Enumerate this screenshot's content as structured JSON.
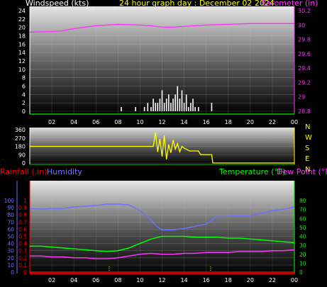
{
  "header": {
    "windspeed_label": "Windspeed (kts)",
    "graph_day": "24 hour graph day : December 02 2024",
    "barometer_label": "Barometer (in)"
  },
  "colors": {
    "background": "#000000",
    "grid": "#c8c8c8",
    "tick_text": "#ffffff",
    "axis_green": "#00cc00",
    "barometer": "#ff33ff",
    "wind_speed": "#ffffff",
    "wind_dir": "#ffff00",
    "rainfall": "#ff0000",
    "humidity": "#7070ff",
    "temperature": "#00ff00",
    "dew_point": "#ff33ff",
    "x_labels": "#ffffff",
    "right_axis_labels": "#ffff00"
  },
  "chart_data": [
    {
      "type": "line",
      "name": "wind-barometer",
      "title": "24 hour graph day : December 02 2024",
      "xlabel": "",
      "ylabel": "Windspeed (kts)",
      "y2label": "Barometer (in)",
      "x_ticks": [
        "02",
        "04",
        "06",
        "08",
        "10",
        "12",
        "14",
        "16",
        "18",
        "20",
        "22",
        "00"
      ],
      "xlim": [
        0,
        24
      ],
      "ylim": [
        0,
        24
      ],
      "y_ticks": [
        "0",
        "2",
        "4",
        "6",
        "8",
        "10",
        "12",
        "14",
        "16",
        "18",
        "20",
        "22",
        "24"
      ],
      "y2lim": [
        28.8,
        30.2
      ],
      "y2_ticks": [
        "28.8",
        "29",
        "29.2",
        "29.4",
        "29.6",
        "29.8",
        "30",
        "30.2"
      ],
      "series": [
        {
          "type": "line",
          "axis": "right",
          "color_key": "barometer",
          "x": [
            0,
            2,
            3,
            4,
            6,
            8,
            10,
            11,
            12,
            13,
            14,
            16,
            18,
            20,
            22,
            24
          ],
          "y": [
            29.9,
            29.91,
            29.92,
            29.95,
            29.99,
            30.01,
            30.0,
            29.99,
            29.97,
            29.97,
            29.98,
            30.0,
            30.01,
            30.02,
            30.02,
            30.02
          ]
        },
        {
          "type": "bar",
          "axis": "left",
          "color_key": "wind_speed",
          "x": [
            8.3,
            9.6,
            10.4,
            10.7,
            11.0,
            11.2,
            11.4,
            11.6,
            11.8,
            12.0,
            12.2,
            12.4,
            12.6,
            12.8,
            13.0,
            13.2,
            13.4,
            13.6,
            13.8,
            14.0,
            14.2,
            14.4,
            14.6,
            14.8,
            15.0,
            15.3,
            16.5
          ],
          "y": [
            1,
            1,
            1,
            2,
            1,
            3,
            2,
            2,
            3,
            5,
            2,
            3,
            4,
            2,
            3,
            4,
            6,
            3,
            5,
            2,
            4,
            1,
            2,
            3,
            1,
            1,
            2
          ]
        }
      ]
    },
    {
      "type": "line",
      "name": "wind-direction",
      "xlim": [
        0,
        24
      ],
      "ylim": [
        0,
        360
      ],
      "y_ticks": [
        "0",
        "90",
        "180",
        "270",
        "360"
      ],
      "y_ticks_values": [
        0,
        90,
        180,
        270,
        360
      ],
      "compass_labels": [
        "N",
        "W",
        "S",
        "E",
        "N"
      ],
      "x": [
        0,
        11.2,
        11.4,
        11.6,
        11.8,
        12.0,
        12.2,
        12.4,
        12.6,
        12.8,
        13.0,
        13.2,
        13.4,
        13.6,
        13.8,
        14.0,
        14.5,
        15.0,
        15.3,
        15.5,
        16.0,
        16.3,
        16.5,
        16.6,
        24
      ],
      "y": [
        180,
        180,
        330,
        120,
        260,
        70,
        300,
        40,
        200,
        110,
        250,
        150,
        210,
        120,
        180,
        160,
        130,
        130,
        130,
        90,
        90,
        90,
        90,
        0,
        0
      ]
    },
    {
      "type": "line",
      "name": "humidity-temperature",
      "left_labels": {
        "rainfall": "Rainfall (.in)",
        "humidity": "Humidity"
      },
      "right_labels": {
        "temperature": "Temperature (°F)",
        "dew_point": "Dew Point (°F)"
      },
      "x_ticks": [
        "02",
        "04",
        "06",
        "08",
        "10",
        "12",
        "14",
        "16",
        "18",
        "20",
        "22",
        "00"
      ],
      "xlim": [
        0,
        24
      ],
      "humidity_ticks": [
        "0",
        "10",
        "20",
        "30",
        "40",
        "50",
        "60",
        "70",
        "80",
        "90",
        "100"
      ],
      "humidity_lim": [
        0,
        100
      ],
      "rain_ticks": [
        "0",
        "0.1",
        "0.2",
        "0.3",
        "0.4",
        "0.5",
        "0.6",
        "0.7",
        "0.8",
        "0.9",
        "1"
      ],
      "rain_lim": [
        0,
        1
      ],
      "temp_ticks": [
        "0",
        "10",
        "20",
        "30",
        "40",
        "50",
        "60",
        "70",
        "80"
      ],
      "temp_lim": [
        0,
        80
      ],
      "series": [
        {
          "name": "Humidity",
          "axis": "humidity",
          "color_key": "humidity",
          "x": [
            0,
            1,
            2,
            3,
            4,
            5,
            6,
            7,
            8,
            9,
            10,
            11,
            11.5,
            12,
            13,
            14,
            15,
            16,
            17,
            18,
            19,
            20,
            21,
            22,
            23,
            24
          ],
          "y": [
            89,
            88,
            89,
            89,
            91,
            92,
            93,
            95,
            95,
            94,
            86,
            73,
            64,
            59,
            59,
            61,
            64,
            67,
            78,
            78,
            79,
            79,
            82,
            86,
            88,
            91
          ]
        },
        {
          "name": "Temperature",
          "axis": "temp",
          "color_key": "temperature",
          "x": [
            0,
            1,
            2,
            3,
            4,
            5,
            6,
            7,
            8,
            9,
            10,
            11,
            12,
            13,
            14,
            15,
            16,
            17,
            18,
            19,
            20,
            21,
            22,
            23,
            24
          ],
          "y": [
            29,
            29,
            28,
            27,
            26,
            25,
            24,
            23,
            24,
            27,
            32,
            37,
            40,
            40,
            40,
            39,
            39,
            39,
            38,
            38,
            37,
            36,
            35,
            34,
            33
          ]
        },
        {
          "name": "Dew Point",
          "axis": "temp",
          "color_key": "dew_point",
          "x": [
            0,
            1,
            2,
            3,
            4,
            5,
            6,
            7,
            8,
            9,
            10,
            11,
            12,
            13,
            14,
            15,
            16,
            17,
            18,
            19,
            20,
            21,
            22,
            23,
            24
          ],
          "y": [
            18,
            18,
            17,
            17,
            16,
            16,
            15,
            15,
            16,
            18,
            20,
            21,
            20,
            20,
            21,
            21,
            22,
            22,
            22,
            23,
            23,
            23,
            24,
            24,
            25
          ]
        },
        {
          "name": "Rainfall",
          "axis": "rain",
          "color_key": "rainfall",
          "x": [
            0,
            24
          ],
          "y": [
            0,
            0
          ]
        }
      ]
    }
  ]
}
